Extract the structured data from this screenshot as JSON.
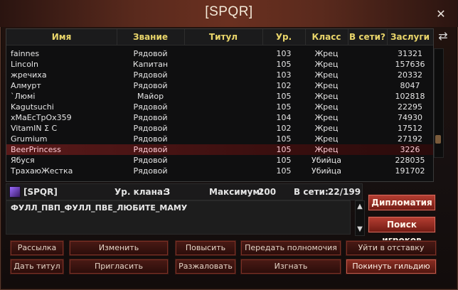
{
  "window": {
    "title": "[SPQR]"
  },
  "table": {
    "columns": [
      "Имя",
      "Звание",
      "Титул",
      "Ур.",
      "Класс",
      "В сети?",
      "Заслуги"
    ],
    "rows": [
      {
        "name": "fainnes",
        "rank": "Рядовой",
        "title": "",
        "level": "103",
        "class": "Жрец",
        "online": "",
        "merit": "31321"
      },
      {
        "name": "Lincoln",
        "rank": "Капитан",
        "title": "",
        "level": "105",
        "class": "Жрец",
        "online": "",
        "merit": "157636"
      },
      {
        "name": "жречиха",
        "rank": "Рядовой",
        "title": "",
        "level": "103",
        "class": "Жрец",
        "online": "",
        "merit": "20332"
      },
      {
        "name": "Алмурт",
        "rank": "Рядовой",
        "title": "",
        "level": "102",
        "class": "Жрец",
        "online": "",
        "merit": "8047"
      },
      {
        "name": "`Люмі",
        "rank": "Майор",
        "title": "",
        "level": "105",
        "class": "Жрец",
        "online": "",
        "merit": "102818"
      },
      {
        "name": "Kagutsuchi",
        "rank": "Рядовой",
        "title": "",
        "level": "105",
        "class": "Жрец",
        "online": "",
        "merit": "22295"
      },
      {
        "name": "xMaEcTpOx359",
        "rank": "Рядовой",
        "title": "",
        "level": "104",
        "class": "Жрец",
        "online": "",
        "merit": "74930"
      },
      {
        "name": "VitamIN Σ C",
        "rank": "Рядовой",
        "title": "",
        "level": "102",
        "class": "Жрец",
        "online": "",
        "merit": "17512"
      },
      {
        "name": "Grumium",
        "rank": "Рядовой",
        "title": "",
        "level": "105",
        "class": "Жрец",
        "online": "",
        "merit": "27192"
      },
      {
        "name": "BeerPrincess",
        "rank": "Рядовой",
        "title": "",
        "level": "105",
        "class": "Жрец",
        "online": "",
        "merit": "3226",
        "selected": true
      },
      {
        "name": "Ябуся",
        "rank": "Рядовой",
        "title": "",
        "level": "105",
        "class": "Убийца",
        "online": "",
        "merit": "228035"
      },
      {
        "name": "ТрахаюЖестка",
        "rank": "Рядовой",
        "title": "",
        "level": "105",
        "class": "Убийца",
        "online": "",
        "merit": "191702"
      }
    ]
  },
  "clan": {
    "name": "[SPQR]",
    "level_label": "Ур. клана:",
    "level": "3",
    "max_label": "Максимум:",
    "max": "200",
    "online_label": "В сети:",
    "online": "22/199"
  },
  "motd": "ФУЛЛ_ПВП_ФУЛЛ_ПВЕ_ЛЮБИТЕ_МАМУ",
  "side_buttons": {
    "diplomacy": "Дипломатия",
    "find_players": "Поиск игроков"
  },
  "buttons": {
    "mail": "Рассылка",
    "change": "Изменить",
    "promote": "Повысить",
    "transfer": "Передать полномочия",
    "resign": "Уйти в отставку",
    "give_title": "Дать титул",
    "invite": "Пригласить",
    "demote": "Разжаловать",
    "expel": "Изгнать",
    "leave": "Покинуть гильдию"
  },
  "icons": {
    "close": "close-icon",
    "refresh": "refresh-icon"
  },
  "colors": {
    "header_text": "#e9d56a",
    "selected_row": "#5a1a1a",
    "button_red": "#8b2e23"
  }
}
